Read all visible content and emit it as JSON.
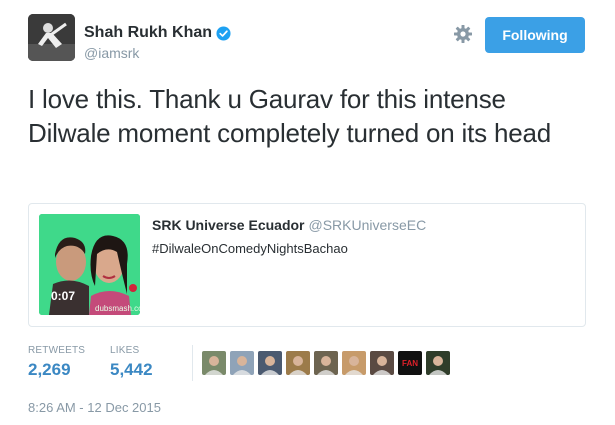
{
  "author": {
    "name": "Shah Rukh Khan",
    "handle": "@iamsrk",
    "verified": true
  },
  "follow_button": {
    "label": "Following",
    "color": "#3ba0e6"
  },
  "tweet": {
    "text": "I love this. Thank u Gaurav for this intense Dilwale moment completely turned on its head"
  },
  "quoted_tweet": {
    "name": "SRK Universe Ecuador",
    "handle": "@SRKUniverseEC",
    "text": "#DilwaleOnComedyNightsBachao",
    "video_duration": "0:07",
    "watermark": "dubsmash.com"
  },
  "stats": {
    "retweets_label": "RETWEETS",
    "retweets": "2,269",
    "likes_label": "LIKES",
    "likes": "5,442"
  },
  "likers": [
    {
      "icon": "liker-avatar-1",
      "color": "#7a8a6a"
    },
    {
      "icon": "liker-avatar-2",
      "color": "#8fa3b8"
    },
    {
      "icon": "liker-avatar-3",
      "color": "#4b5a70"
    },
    {
      "icon": "liker-avatar-4",
      "color": "#9c7b4a"
    },
    {
      "icon": "liker-avatar-5",
      "color": "#6d6450"
    },
    {
      "icon": "liker-avatar-6",
      "color": "#c79b6a"
    },
    {
      "icon": "liker-avatar-7",
      "color": "#5a4a42"
    },
    {
      "icon": "liker-avatar-8",
      "color": "#111111",
      "text": "FAN"
    },
    {
      "icon": "liker-avatar-9",
      "color": "#2f3d2a"
    }
  ],
  "timestamp": "8:26 AM - 12 Dec 2015"
}
